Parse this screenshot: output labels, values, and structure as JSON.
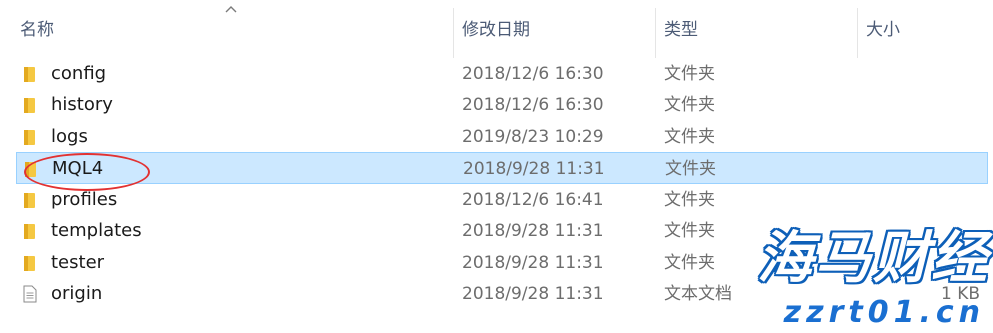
{
  "columns": {
    "name": "名称",
    "date": "修改日期",
    "type": "类型",
    "size": "大小"
  },
  "sort": {
    "column": "name",
    "direction": "ascending",
    "icon": "chevron-up-icon"
  },
  "accent": {
    "selection_bg": "#cce8ff",
    "selection_border": "#99d1ff",
    "annotation": "#e23232",
    "folder": "#f5c842"
  },
  "rows": [
    {
      "name": "config",
      "date": "2018/12/6 16:30",
      "type": "文件夹",
      "size": "",
      "icon": "folder-icon",
      "selected": false
    },
    {
      "name": "history",
      "date": "2018/12/6 16:30",
      "type": "文件夹",
      "size": "",
      "icon": "folder-icon",
      "selected": false
    },
    {
      "name": "logs",
      "date": "2019/8/23 10:29",
      "type": "文件夹",
      "size": "",
      "icon": "folder-icon",
      "selected": false
    },
    {
      "name": "MQL4",
      "date": "2018/9/28 11:31",
      "type": "文件夹",
      "size": "",
      "icon": "folder-icon",
      "selected": true
    },
    {
      "name": "profiles",
      "date": "2018/12/6 16:41",
      "type": "文件夹",
      "size": "",
      "icon": "folder-icon",
      "selected": false
    },
    {
      "name": "templates",
      "date": "2018/9/28 11:31",
      "type": "文件夹",
      "size": "",
      "icon": "folder-icon",
      "selected": false
    },
    {
      "name": "tester",
      "date": "2018/9/28 11:31",
      "type": "文件夹",
      "size": "",
      "icon": "folder-icon",
      "selected": false
    },
    {
      "name": "origin",
      "date": "2018/9/28 11:31",
      "type": "文本文档",
      "size": "1 KB",
      "icon": "text-file-icon",
      "selected": false
    }
  ],
  "watermark": {
    "brand": "海马财经",
    "url": "zzrt01.cn"
  }
}
